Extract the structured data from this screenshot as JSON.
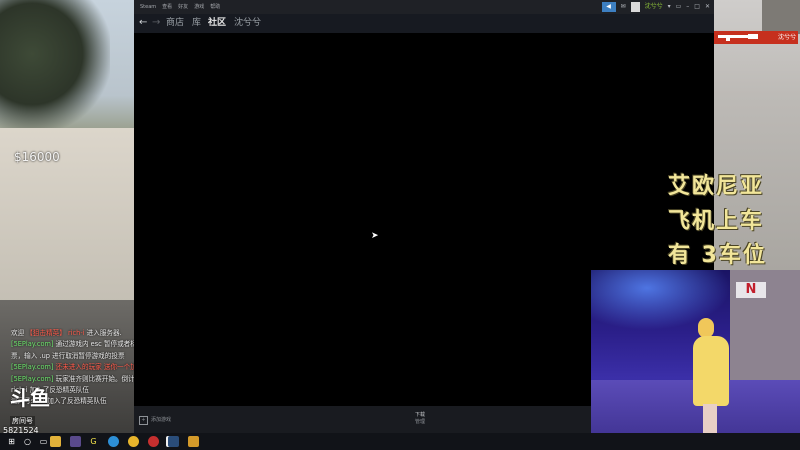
{
  "game": {
    "money": "$16000",
    "chat_lines": [
      {
        "prefix": "欢迎",
        "highlight": "【狙击精英】",
        "highlight_color": "red",
        "name": "rich-i",
        "rest": "进入服务器."
      },
      {
        "prefix": "",
        "highlight": "[5EPlay.com]",
        "highlight_color": "green",
        "name": "",
        "rest": "通过游戏内 esc 暂停或者标"
      },
      {
        "prefix": "",
        "highlight": "",
        "highlight_color": "",
        "name": "",
        "rest": "票，输入 .up 进行取消暂停游戏的投票"
      },
      {
        "prefix": "",
        "highlight": "[5EPlay.com]",
        "highlight_color": "green",
        "name": "",
        "rest": "还未进入的玩家 送你一个加"
      },
      {
        "prefix": "",
        "highlight": "[5EPlay.com]",
        "highlight_color": "green",
        "name": "",
        "rest": "玩家准齐则比赛开始。倒计"
      },
      {
        "prefix": "",
        "highlight": "",
        "highlight_color": "",
        "name": "",
        "rest": "rich-i 加入了反恐精英队伍"
      },
      {
        "prefix": "",
        "highlight": "",
        "highlight_color": "",
        "name": "",
        "rest": "追风号sanr 加入了反恐精英队伍"
      }
    ],
    "logo_glyph": "斗鱼",
    "logo_sub": "房间号",
    "room_number": "5821524"
  },
  "steam": {
    "menu": [
      "Steam",
      "查看",
      "好友",
      "游戏",
      "帮助"
    ],
    "user_name": "沈兮兮",
    "nav": {
      "back": "←",
      "forward": "→",
      "links": [
        {
          "label": "商店",
          "active": false
        },
        {
          "label": "库",
          "active": false
        },
        {
          "label": "社区",
          "active": true
        },
        {
          "label": "沈兮兮",
          "active": false
        }
      ]
    },
    "status": {
      "add_game": "添加游戏",
      "downloads_title": "下载",
      "downloads_sub": "管理"
    }
  },
  "overlay": {
    "handwritten": [
      "艾欧尼亚",
      "飞机上车",
      "有 3车位"
    ],
    "gun_badge_text": "沈兮兮"
  },
  "taskbar": {
    "icons": [
      "windows-icon",
      "search-icon",
      "task-view-icon",
      "file-explorer-icon",
      "media-icon",
      "app-g-icon",
      "edge-icon",
      "chrome-icon",
      "netease-music-icon",
      "douyu-icon",
      "steam-icon",
      "folder-icon"
    ]
  },
  "colors": {
    "steam_accent": "#3d7fc1",
    "steam_online_green": "#8fc43a",
    "chat_red": "#ff5a4a",
    "chat_green": "#6be36b",
    "handwriting_yellow": "#f2e69a"
  }
}
